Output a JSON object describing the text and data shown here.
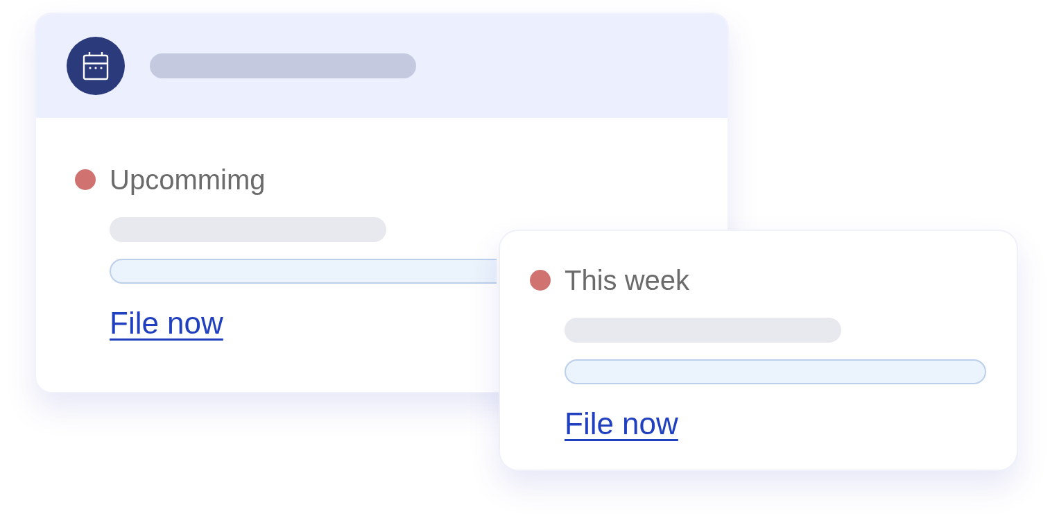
{
  "cards": [
    {
      "kind": "header_card",
      "status": "Upcommimg",
      "color": "#d07370",
      "link": "File now"
    },
    {
      "kind": "plain_card",
      "status": "This week",
      "color": "#d07370",
      "link": "File now"
    }
  ]
}
